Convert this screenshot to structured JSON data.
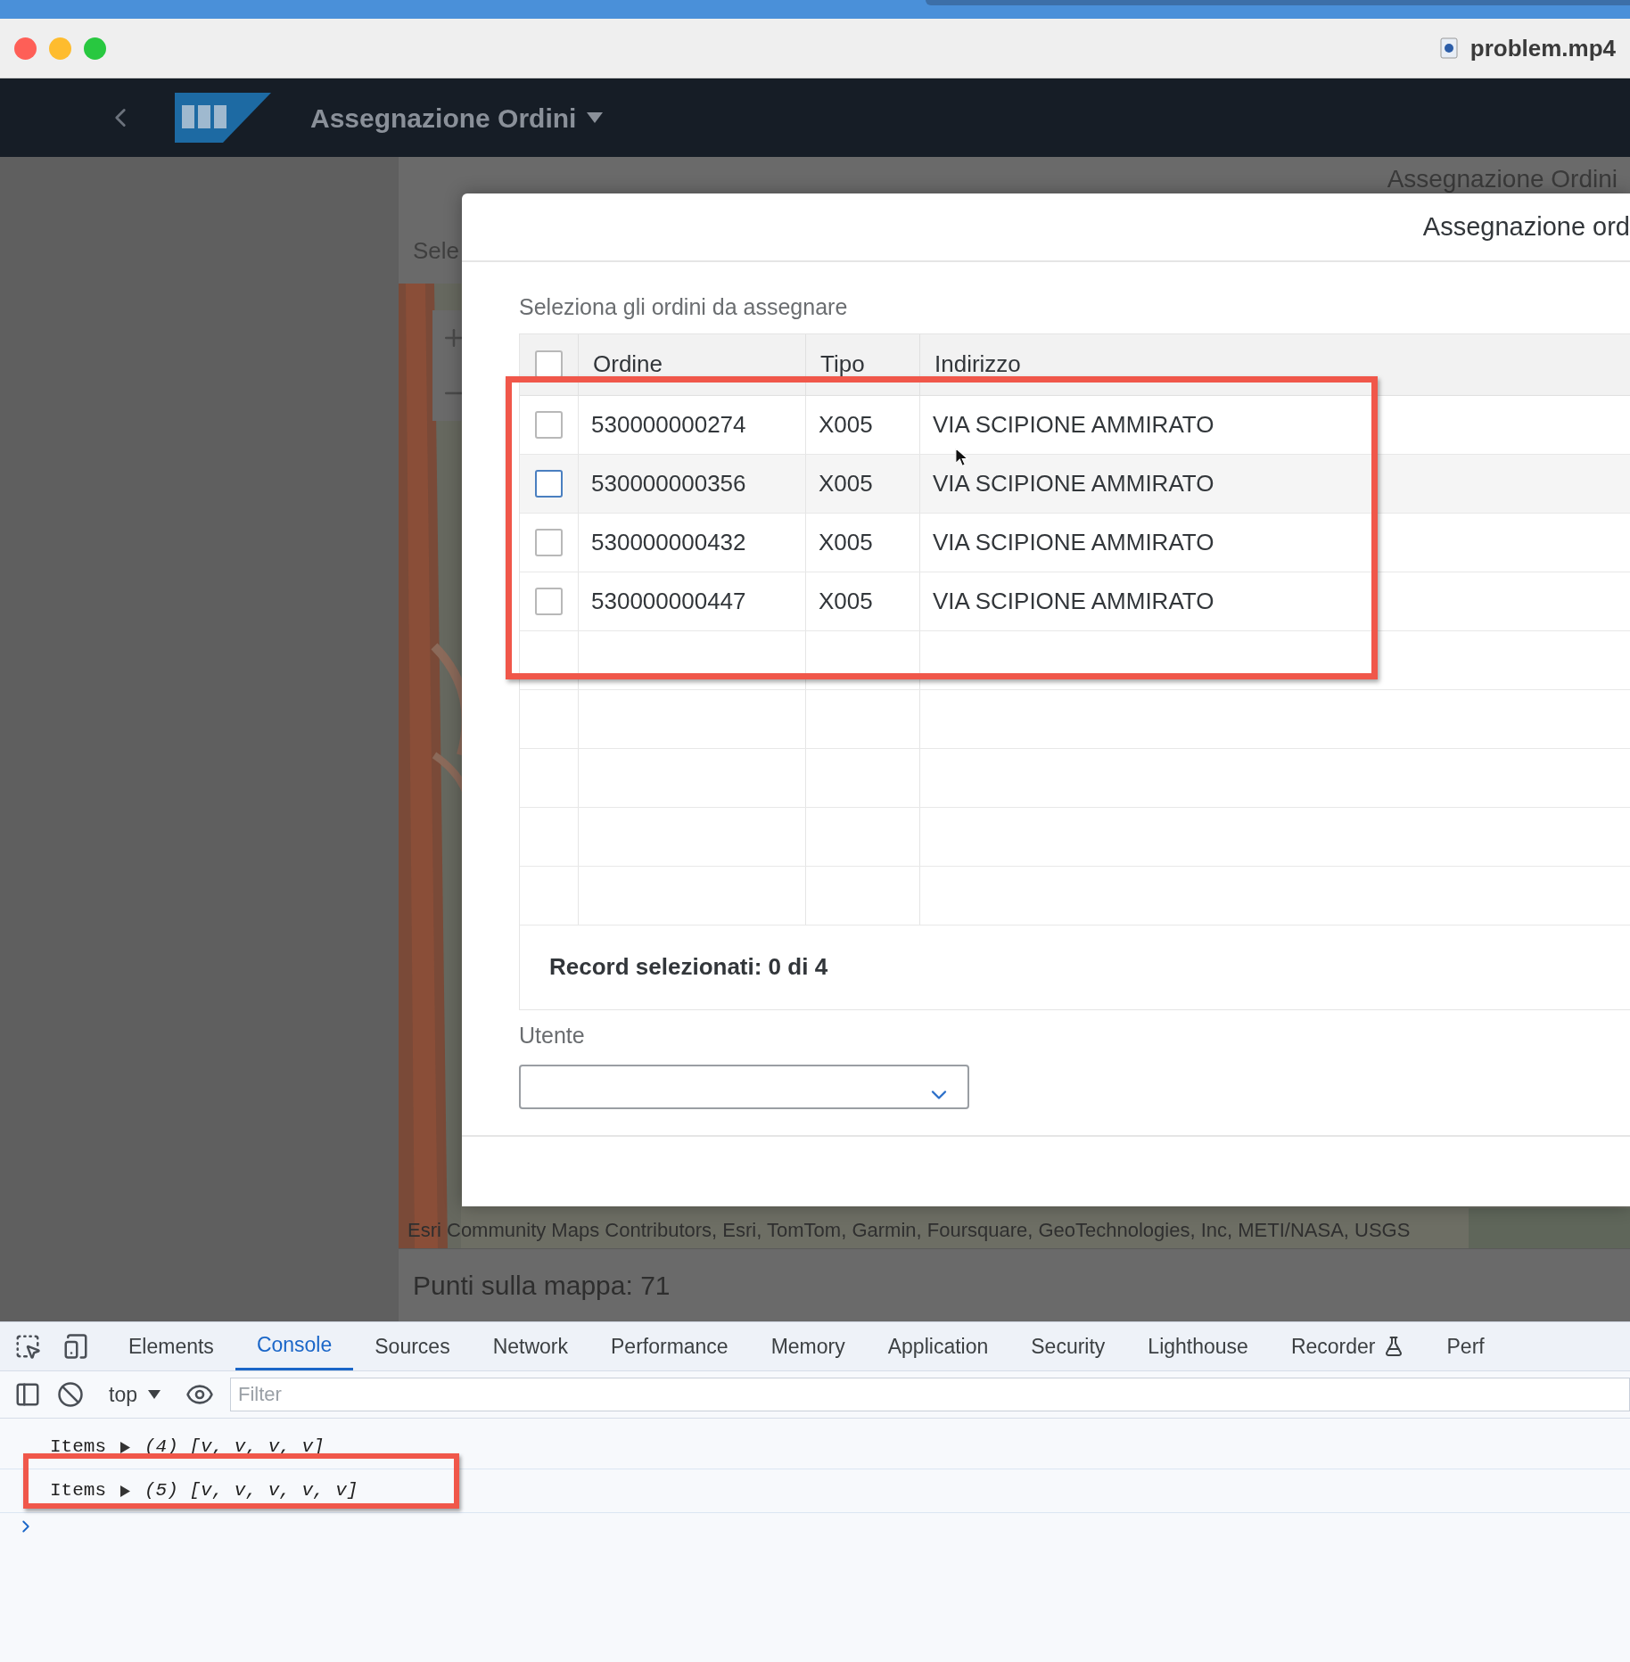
{
  "browser": {
    "tab_title": "problem.mp4"
  },
  "shell": {
    "title": "Assegnazione Ordini"
  },
  "page": {
    "heading": "Assegnazione Ordini",
    "side_label": "Sele",
    "map_attribution": "Esri Community Maps Contributors, Esri, TomTom, Garmin, Foursquare, GeoTechnologies, Inc, METI/NASA, USGS",
    "points": "Punti sulla mappa: 71"
  },
  "dialog": {
    "title": "Assegnazione ord",
    "table_label": "Seleziona gli ordini da assegnare",
    "select_all": {
      "checked": false
    },
    "columns": [
      "Ordine",
      "Tipo",
      "Indirizzo"
    ],
    "rows": [
      {
        "ordine": "530000000274",
        "tipo": "X005",
        "indirizzo": "VIA SCIPIONE AMMIRATO",
        "checked": false,
        "hovered": false
      },
      {
        "ordine": "530000000356",
        "tipo": "X005",
        "indirizzo": "VIA SCIPIONE AMMIRATO",
        "checked": false,
        "hovered": true
      },
      {
        "ordine": "530000000432",
        "tipo": "X005",
        "indirizzo": "VIA SCIPIONE AMMIRATO",
        "checked": false,
        "hovered": false
      },
      {
        "ordine": "530000000447",
        "tipo": "X005",
        "indirizzo": "VIA SCIPIONE AMMIRATO",
        "checked": false,
        "hovered": false
      }
    ],
    "footer": "Record selezionati: 0 di 4",
    "user_label": "Utente"
  },
  "devtools": {
    "tabs": [
      {
        "label": "Elements",
        "selected": false
      },
      {
        "label": "Console",
        "selected": true
      },
      {
        "label": "Sources",
        "selected": false
      },
      {
        "label": "Network",
        "selected": false
      },
      {
        "label": "Performance",
        "selected": false
      },
      {
        "label": "Memory",
        "selected": false
      },
      {
        "label": "Application",
        "selected": false
      },
      {
        "label": "Security",
        "selected": false
      },
      {
        "label": "Lighthouse",
        "selected": false
      },
      {
        "label": "Recorder",
        "selected": false,
        "kind": "experimental"
      },
      {
        "label": "Perf",
        "selected": false
      }
    ],
    "context": "top",
    "filter_placeholder": "Filter",
    "console": [
      {
        "label": "Items",
        "value": "(4) [v, v, v, v]"
      },
      {
        "label": "Items",
        "value": "(5) [v, v, v, v, v]"
      }
    ]
  }
}
